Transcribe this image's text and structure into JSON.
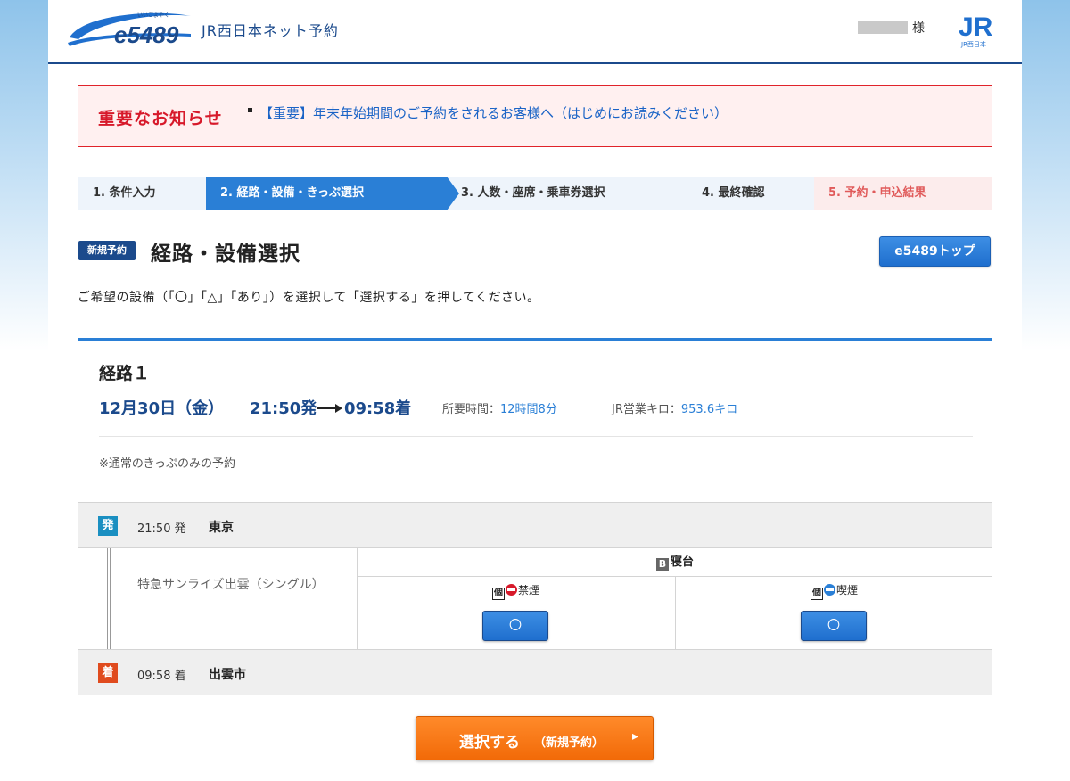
{
  "header": {
    "logo_text": "e5489",
    "logo_ruby": "いいごよやく",
    "site_title": "JR西日本ネット予約",
    "user_suffix": "様",
    "jr_logo_text": "JR",
    "jr_logo_sub": "JR西日本"
  },
  "notice": {
    "title": "重要なお知らせ",
    "link": "【重要】年末年始期間のご予約をされるお客様へ（はじめにお読みください）"
  },
  "steps": [
    {
      "label": "1. 条件入力",
      "state": "done"
    },
    {
      "label": "2. 経路・設備・きっぷ選択",
      "state": "current"
    },
    {
      "label": "3. 人数・座席・乗車券選択",
      "state": "upcoming"
    },
    {
      "label": "4. 最終確認",
      "state": "upcoming"
    },
    {
      "label": "5. 予約・申込結果",
      "state": "upcoming"
    }
  ],
  "title_row": {
    "badge": "新規予約",
    "title": "経路・設備選択",
    "top_button": "e5489トップ"
  },
  "instruction": "ご希望の設備（「〇」「△」「あり」）を選択して「選択する」を押してください。",
  "route": {
    "name": "経路１",
    "date": "12月30日（金）",
    "depart_time": "21:50発",
    "arrive_time": "09:58着",
    "duration_label": "所要時間：",
    "duration_value": "12時間8分",
    "distance_label": "JR営業キロ：",
    "distance_value": "953.6キロ",
    "note": "※通常のきっぷのみの予約",
    "departure": {
      "icon": "発",
      "time": "21:50 発",
      "station": "東京"
    },
    "arrival": {
      "icon": "着",
      "time": "09:58 着",
      "station": "出雲市"
    },
    "train_name": "特急サンライズ出雲（シングル）",
    "seat_class_mark": "B",
    "seat_class": "寝台",
    "seat_options": [
      {
        "box": "個",
        "label": "禁煙",
        "symbol": "〇"
      },
      {
        "box": "個",
        "label": "喫煙",
        "symbol": "〇"
      }
    ]
  },
  "submit": {
    "label": "選択する",
    "sub": "（新規予約）",
    "chevron": "▸"
  },
  "colors": {
    "brand_navy": "#1b4a8c",
    "accent_blue": "#2a7fd6",
    "notice_red": "#d7192a",
    "submit_orange": "#f26a08"
  }
}
